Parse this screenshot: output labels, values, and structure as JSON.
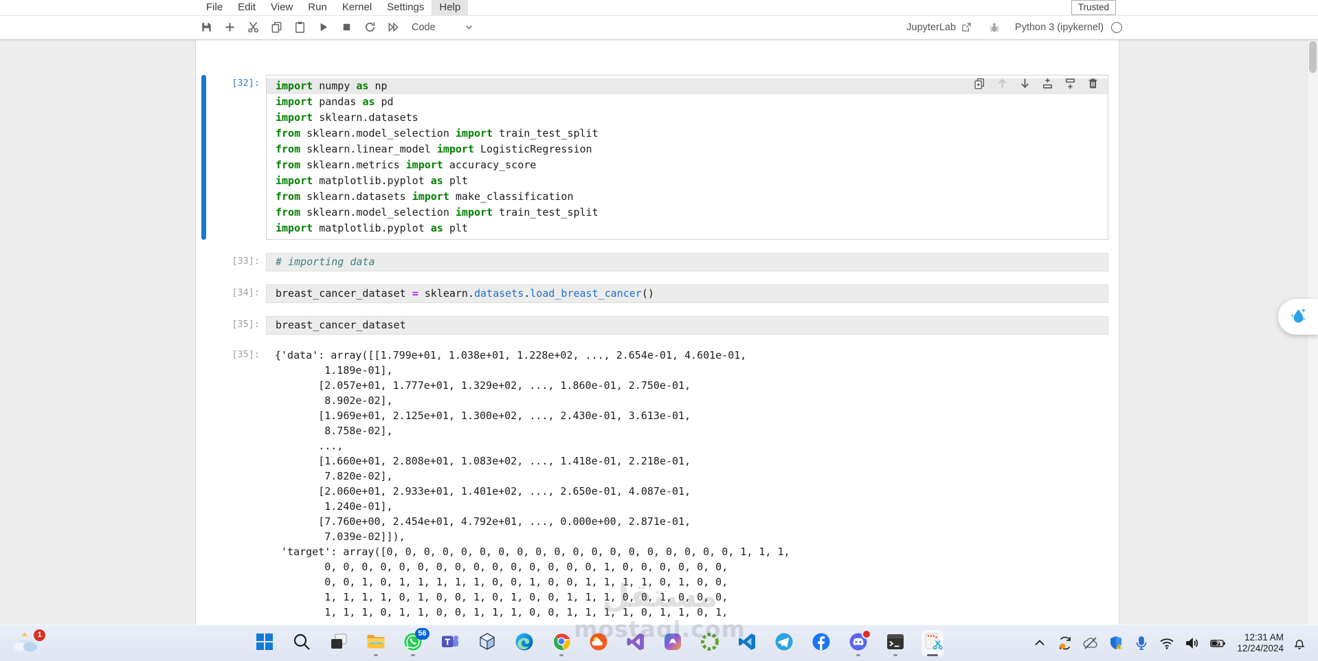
{
  "menu_bar": {
    "items": [
      "File",
      "Edit",
      "View",
      "Run",
      "Kernel",
      "Settings",
      "Help"
    ],
    "active_item": "Help",
    "trusted_label": "Trusted"
  },
  "toolbar": {
    "buttons": [
      {
        "icon": "save",
        "name": "save-button"
      },
      {
        "icon": "add",
        "name": "insert-cell-button"
      },
      {
        "icon": "cut",
        "name": "cut-cells-button"
      },
      {
        "icon": "copy",
        "name": "copy-cells-button"
      },
      {
        "icon": "paste",
        "name": "paste-cells-button"
      },
      {
        "icon": "run",
        "name": "run-cell-button"
      },
      {
        "icon": "stop",
        "name": "interrupt-kernel-button"
      },
      {
        "icon": "restart",
        "name": "restart-kernel-button"
      },
      {
        "icon": "runall",
        "name": "restart-run-all-button"
      }
    ],
    "cell_type": "Code",
    "jupyterlab_label": "JupyterLab",
    "kernel_name": "Python 3 (ipykernel)"
  },
  "cell_toolbar": [
    {
      "icon": "duplicate",
      "name": "duplicate-cell-button"
    },
    {
      "icon": "moveup",
      "name": "move-cell-up-button",
      "disabled": true
    },
    {
      "icon": "movedown",
      "name": "move-cell-down-button"
    },
    {
      "icon": "insertabove",
      "name": "insert-cell-above-button"
    },
    {
      "icon": "insertbelow",
      "name": "insert-cell-below-button"
    },
    {
      "icon": "delete",
      "name": "delete-cell-button"
    }
  ],
  "cells": [
    {
      "prompt": "[32]:",
      "active": true,
      "lines": [
        [
          {
            "c": "kw",
            "s": "import"
          },
          {
            "c": "pl",
            "s": " numpy "
          },
          {
            "c": "kw",
            "s": "as"
          },
          {
            "c": "pl",
            "s": " np"
          }
        ],
        [
          {
            "c": "kw",
            "s": "import"
          },
          {
            "c": "pl",
            "s": " pandas "
          },
          {
            "c": "kw",
            "s": "as"
          },
          {
            "c": "pl",
            "s": " pd"
          }
        ],
        [
          {
            "c": "kw",
            "s": "import"
          },
          {
            "c": "pl",
            "s": " sklearn.datasets"
          }
        ],
        [
          {
            "c": "kw",
            "s": "from"
          },
          {
            "c": "pl",
            "s": " sklearn.model_selection "
          },
          {
            "c": "kw",
            "s": "import"
          },
          {
            "c": "pl",
            "s": " train_test_split"
          }
        ],
        [
          {
            "c": "kw",
            "s": "from"
          },
          {
            "c": "pl",
            "s": " sklearn.linear_model "
          },
          {
            "c": "kw",
            "s": "import"
          },
          {
            "c": "pl",
            "s": " LogisticRegression"
          }
        ],
        [
          {
            "c": "kw",
            "s": "from"
          },
          {
            "c": "pl",
            "s": " sklearn.metrics "
          },
          {
            "c": "kw",
            "s": "import"
          },
          {
            "c": "pl",
            "s": " accuracy_score"
          }
        ],
        [
          {
            "c": "kw",
            "s": "import"
          },
          {
            "c": "pl",
            "s": " matplotlib.pyplot "
          },
          {
            "c": "kw",
            "s": "as"
          },
          {
            "c": "pl",
            "s": " plt"
          }
        ],
        [
          {
            "c": "kw",
            "s": "from"
          },
          {
            "c": "pl",
            "s": " sklearn.datasets "
          },
          {
            "c": "kw",
            "s": "import"
          },
          {
            "c": "pl",
            "s": " make_classification"
          }
        ],
        [
          {
            "c": "kw",
            "s": "from"
          },
          {
            "c": "pl",
            "s": " sklearn.model_selection "
          },
          {
            "c": "kw",
            "s": "import"
          },
          {
            "c": "pl",
            "s": " train_test_split"
          }
        ],
        [
          {
            "c": "kw",
            "s": "import"
          },
          {
            "c": "pl",
            "s": " matplotlib.pyplot "
          },
          {
            "c": "kw",
            "s": "as"
          },
          {
            "c": "pl",
            "s": " plt"
          }
        ]
      ]
    },
    {
      "prompt": "[33]:",
      "active": false,
      "lines": [
        [
          {
            "c": "cm",
            "s": "# importing data"
          }
        ]
      ]
    },
    {
      "prompt": "[34]:",
      "active": false,
      "lines": [
        [
          {
            "c": "pl",
            "s": "breast_cancer_dataset "
          },
          {
            "c": "op",
            "s": "="
          },
          {
            "c": "pl",
            "s": " sklearn."
          },
          {
            "c": "prop",
            "s": "datasets"
          },
          {
            "c": "pl",
            "s": "."
          },
          {
            "c": "prop",
            "s": "load_breast_cancer"
          },
          {
            "c": "pl",
            "s": "()"
          }
        ]
      ]
    },
    {
      "prompt": "[35]:",
      "active": false,
      "lines": [
        [
          {
            "c": "pl",
            "s": "breast_cancer_dataset"
          }
        ]
      ]
    }
  ],
  "output": {
    "prompt": "[35]:",
    "lines": [
      "{'data': array([[1.799e+01, 1.038e+01, 1.228e+02, ..., 2.654e-01, 4.601e-01,",
      "        1.189e-01],",
      "       [2.057e+01, 1.777e+01, 1.329e+02, ..., 1.860e-01, 2.750e-01,",
      "        8.902e-02],",
      "       [1.969e+01, 2.125e+01, 1.300e+02, ..., 2.430e-01, 3.613e-01,",
      "        8.758e-02],",
      "       ...,",
      "       [1.660e+01, 2.808e+01, 1.083e+02, ..., 1.418e-01, 2.218e-01,",
      "        7.820e-02],",
      "       [2.060e+01, 2.933e+01, 1.401e+02, ..., 2.650e-01, 4.087e-01,",
      "        1.240e-01],",
      "       [7.760e+00, 2.454e+01, 4.792e+01, ..., 0.000e+00, 2.871e-01,",
      "        7.039e-02]]),",
      " 'target': array([0, 0, 0, 0, 0, 0, 0, 0, 0, 0, 0, 0, 0, 0, 0, 0, 0, 0, 0, 1, 1, 1,",
      "        0, 0, 0, 0, 0, 0, 0, 0, 0, 0, 0, 0, 0, 0, 0, 1, 0, 0, 0, 0, 0, 0,",
      "        0, 0, 1, 0, 1, 1, 1, 1, 1, 0, 0, 1, 0, 0, 1, 1, 1, 1, 0, 1, 0, 0,",
      "        1, 1, 1, 1, 0, 1, 0, 0, 1, 0, 1, 0, 0, 1, 1, 1, 0, 0, 1, 0, 0, 0,",
      "        1, 1, 1, 0, 1, 1, 0, 0, 1, 1, 1, 0, 0, 1, 1, 1, 1, 0, 1, 1, 0, 1,"
    ]
  },
  "watermark": {
    "line1": "مستقل",
    "line2": "mostaql.com"
  },
  "taskbar": {
    "weather_badge": "1",
    "apps": [
      {
        "icon": "start",
        "name": "start-button"
      },
      {
        "icon": "search",
        "name": "search-button"
      },
      {
        "icon": "taskview",
        "name": "task-view-button"
      },
      {
        "icon": "explorer",
        "name": "file-explorer-button",
        "indicator": true
      },
      {
        "icon": "whatsapp",
        "name": "whatsapp-button",
        "badge": "56",
        "indicator": true
      },
      {
        "icon": "teams",
        "name": "teams-button"
      },
      {
        "icon": "box3d",
        "name": "3d-box-app-button"
      },
      {
        "icon": "edge",
        "name": "edge-button"
      },
      {
        "icon": "chrome",
        "name": "chrome-button",
        "indicator": true
      },
      {
        "icon": "weatherapp",
        "name": "weather-app-button"
      },
      {
        "icon": "visualstudio",
        "name": "visual-studio-button"
      },
      {
        "icon": "copilot",
        "name": "copilot-button"
      },
      {
        "icon": "greenring",
        "name": "green-ring-app-button"
      },
      {
        "icon": "vscode",
        "name": "vscode-button"
      },
      {
        "icon": "telegram",
        "name": "telegram-button"
      },
      {
        "icon": "facebook",
        "name": "facebook-button"
      },
      {
        "icon": "discord",
        "name": "discord-button",
        "dot": true,
        "indicator": true
      },
      {
        "icon": "terminal",
        "name": "terminal-button",
        "indicator": true
      },
      {
        "icon": "snipping",
        "name": "snipping-tool-button",
        "active": true,
        "indicator": "wide"
      }
    ],
    "tray": [
      {
        "icon": "chevronup",
        "name": "tray-expand-button"
      },
      {
        "icon": "sync",
        "name": "tray-sync-icon"
      },
      {
        "icon": "cloudoff",
        "name": "tray-onedrive-icon"
      },
      {
        "icon": "shield",
        "name": "tray-security-icon"
      },
      {
        "icon": "mic",
        "name": "tray-microphone-icon"
      },
      {
        "icon": "wifi",
        "name": "tray-wifi-icon"
      },
      {
        "icon": "volume",
        "name": "tray-volume-icon"
      },
      {
        "icon": "battery",
        "name": "tray-battery-icon"
      }
    ],
    "clock": {
      "time": "12:31 AM",
      "date": "12/24/2024"
    }
  }
}
